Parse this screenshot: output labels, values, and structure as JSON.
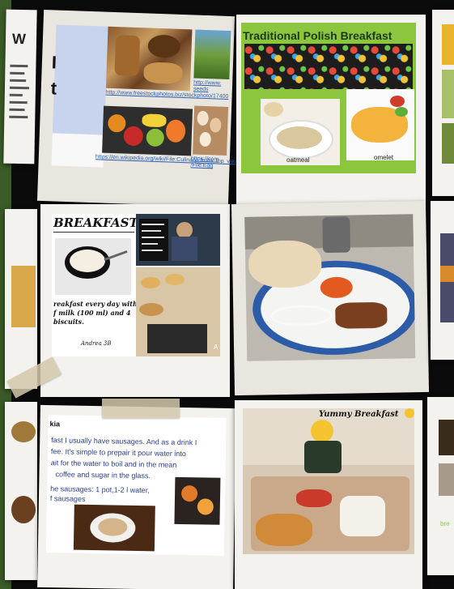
{
  "cards": {
    "top_left": {
      "heading_fragment": "W",
      "big_letters": [
        "I",
        "t"
      ],
      "link_1": "http://www.freestockphotos.biz/stockphoto/17400",
      "link_2": "http://www.\nseeds",
      "link_3": "https://en.wikipedia.org/wiki/File:Culinary_fruits_top_view.jpg",
      "link_4": "https://com\n/File:Egg"
    },
    "polish": {
      "title": "Traditional Polish Breakfast",
      "label_oatmeal": "oatmeal",
      "label_omelet": "omelet"
    },
    "breakfast": {
      "heading": "BREAKFAST.",
      "caption": "reakfast every day with a\nf milk (100 ml) and 4\nbiscuits.",
      "author": "Andrea 3B",
      "corner": "A"
    },
    "sausage": {
      "heading": "kia",
      "line_1": "fast I usually have sausages. And as a drink I",
      "line_2": "fee.  It's simple to prepair it pour water into",
      "line_3": "ait for the water to boil and in the mean",
      "line_4": "coffee and sugar in the glass.",
      "line_5": "he sausages: 1 pot,1-2 l water,",
      "line_6": "f sausages"
    },
    "yummy": {
      "title": "Yummy Breakfast"
    },
    "right_bottom": {
      "fragment": "bre"
    }
  },
  "colors": {
    "polish_frame": "#8cc63f",
    "left_stripe": "#3a5a27"
  }
}
